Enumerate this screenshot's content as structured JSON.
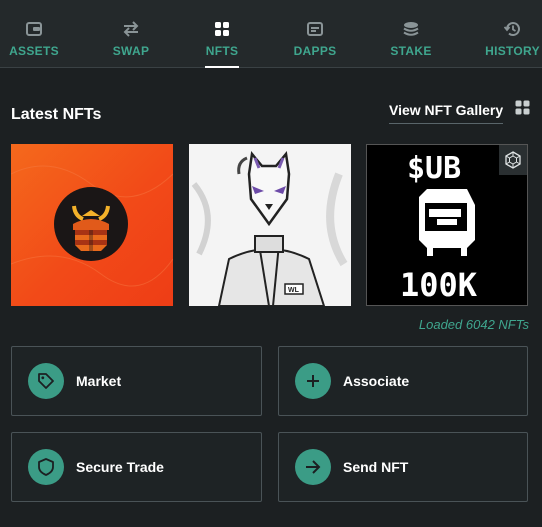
{
  "tabs": [
    {
      "label": "ASSETS",
      "icon": "wallet-icon",
      "active": false
    },
    {
      "label": "SWAP",
      "icon": "swap-arrows-icon",
      "active": false
    },
    {
      "label": "NFTS",
      "icon": "grid-icon",
      "active": true
    },
    {
      "label": "DAPPS",
      "icon": "browser-icon",
      "active": false
    },
    {
      "label": "STAKE",
      "icon": "coin-stack-icon",
      "active": false
    },
    {
      "label": "HISTORY",
      "icon": "history-icon",
      "active": false
    }
  ],
  "section": {
    "title": "Latest NFTs",
    "gallery_label": "View NFT Gallery"
  },
  "nfts": [
    {
      "name": "samurai-helmet-nft"
    },
    {
      "name": "fox-mask-character-nft",
      "badge_text": "WL"
    },
    {
      "name": "pixel-sub-100k-nft",
      "top_text": "$UB",
      "bottom_text": "100K"
    }
  ],
  "loaded_text": "Loaded 6042 NFTs",
  "actions": [
    {
      "label": "Market",
      "icon": "tag-icon"
    },
    {
      "label": "Associate",
      "icon": "plus-icon"
    },
    {
      "label": "Secure Trade",
      "icon": "shield-icon"
    },
    {
      "label": "Send NFT",
      "icon": "arrow-right-icon"
    }
  ],
  "colors": {
    "accent": "#3fa68e",
    "button_circle": "#3b9c86",
    "background": "#1c2022",
    "tabbar": "#24292b"
  }
}
